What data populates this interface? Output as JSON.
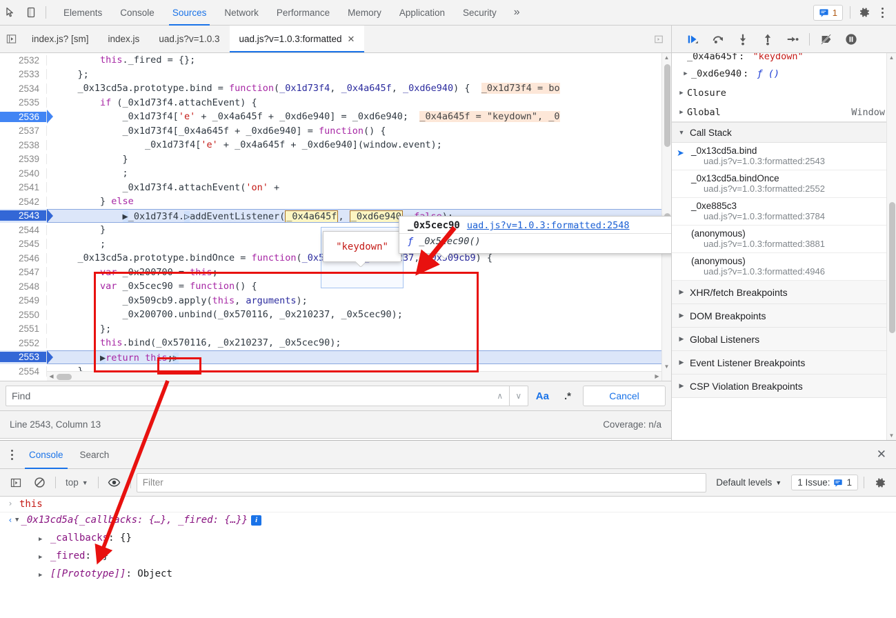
{
  "toolbar": {
    "inspect_icon": "inspect-cursor-icon",
    "device_icon": "device-toggle-icon",
    "panels": [
      {
        "label": "Elements",
        "active": false
      },
      {
        "label": "Console",
        "active": false
      },
      {
        "label": "Sources",
        "active": true
      },
      {
        "label": "Network",
        "active": false
      },
      {
        "label": "Performance",
        "active": false
      },
      {
        "label": "Memory",
        "active": false
      },
      {
        "label": "Application",
        "active": false
      },
      {
        "label": "Security",
        "active": false
      }
    ],
    "more_label": "»",
    "issues_count": "1",
    "accent": "#1a73e8"
  },
  "file_tabs": {
    "navigator_toggle": "show-navigator-icon",
    "tabs": [
      {
        "label": "index.js? [sm]",
        "active": false,
        "closable": false
      },
      {
        "label": "index.js",
        "active": false,
        "closable": false
      },
      {
        "label": "uad.js?v=1.0.3",
        "active": false,
        "closable": false
      },
      {
        "label": "uad.js?v=1.0.3:formatted",
        "active": true,
        "closable": true
      }
    ],
    "more_tabs_icon": "more-tabs-icon"
  },
  "debug_controls": [
    {
      "name": "resume-script-execution",
      "icon": "resume-icon"
    },
    {
      "name": "step-over-next-function-call",
      "icon": "step-over-icon"
    },
    {
      "name": "step-into-next-function-call",
      "icon": "step-into-icon"
    },
    {
      "name": "step-out-of-current-function",
      "icon": "step-out-icon"
    },
    {
      "name": "step",
      "icon": "step-icon"
    },
    {
      "name": "deactivate-breakpoints",
      "icon": "deactivate-breakpoints-icon"
    },
    {
      "name": "pause-on-exceptions",
      "icon": "pause-on-exceptions-icon"
    }
  ],
  "editor": {
    "lines": [
      {
        "num": "2532",
        "state": "normal",
        "code": "        this._fired = {};"
      },
      {
        "num": "2533",
        "state": "normal",
        "code": "    };"
      },
      {
        "num": "2534",
        "state": "normal",
        "code": "    _0x13cd5a.prototype.bind = function(_0x1d73f4, _0x4a645f, _0xd6e940) {",
        "hint": "_0x1d73f4 = bo"
      },
      {
        "num": "2535",
        "state": "normal",
        "code": "        if (_0x1d73f4.attachEvent) {"
      },
      {
        "num": "2536",
        "state": "breakpoint",
        "code": "            _0x1d73f4['e' + _0x4a645f + _0xd6e940] = _0xd6e940;",
        "hint": "_0x4a645f = \"keydown\", _0"
      },
      {
        "num": "2537",
        "state": "normal",
        "code": "            _0x1d73f4[_0x4a645f + _0xd6e940] = function() {"
      },
      {
        "num": "2538",
        "state": "normal",
        "code": "                _0x1d73f4['e' + _0x4a645f + _0xd6e940](window.event);"
      },
      {
        "num": "2539",
        "state": "normal",
        "code": "            }"
      },
      {
        "num": "2540",
        "state": "normal",
        "code": "            ;"
      },
      {
        "num": "2541",
        "state": "normal",
        "code": "            _0x1d73f4.attachEvent('on' + "
      },
      {
        "num": "2542",
        "state": "normal",
        "code": "        } else"
      },
      {
        "num": "2543",
        "state": "executing",
        "code": "            _0x1d73f4.addEventListener(_0x4a645f, _0xd6e940, false);"
      },
      {
        "num": "2544",
        "state": "normal",
        "code": "        }"
      },
      {
        "num": "2545",
        "state": "normal",
        "code": "        ;"
      },
      {
        "num": "2546",
        "state": "normal",
        "code": "    _0x13cd5a.prototype.bindOnce = function(_0x570116, _0x210237, _0x509cb9) {"
      },
      {
        "num": "2547",
        "state": "normal",
        "code": "        var _0x200700 = this;"
      },
      {
        "num": "2548",
        "state": "normal",
        "code": "        var _0x5cec90 = function() {"
      },
      {
        "num": "2549",
        "state": "normal",
        "code": "            _0x509cb9.apply(this, arguments);"
      },
      {
        "num": "2550",
        "state": "normal",
        "code": "            _0x200700.unbind(_0x570116, _0x210237, _0x5cec90);"
      },
      {
        "num": "2551",
        "state": "normal",
        "code": "        };"
      },
      {
        "num": "2552",
        "state": "normal",
        "code": "        this.bind(_0x570116, _0x210237, _0x5cec90);"
      },
      {
        "num": "2553",
        "state": "executing",
        "code": "        return this;"
      },
      {
        "num": "2554",
        "state": "normal",
        "code": "    }"
      }
    ],
    "highlighted_tokens": [
      "_0x4a645f",
      "_0xd6e940",
      "this;"
    ]
  },
  "popups": {
    "value_tooltip": {
      "text": "\"keydown\"",
      "target_token": "_0x4a645f"
    },
    "function_tooltip": {
      "name": "_0x5cec90",
      "location": "uad.js?v=1.0.3:formatted:2548",
      "signature": "_0x5cec90()",
      "signature_prefix": "ƒ",
      "target_token": "_0xd6e940"
    }
  },
  "find_bar": {
    "placeholder": "Find",
    "value": "",
    "prev_label": "∧",
    "next_label": "∨",
    "match_case_label": "Aa",
    "regex_label": ".*",
    "cancel_label": "Cancel"
  },
  "status_bar": {
    "position": "Line 2543, Column 13",
    "coverage": "Coverage: n/a"
  },
  "sidebar": {
    "scope_rows": [
      {
        "indent": 1,
        "tri": "",
        "name": "_0x4a645f",
        "sep": ":",
        "value": "\"keydown\"",
        "value_kind": "string",
        "clipped": true
      },
      {
        "indent": 1,
        "tri": "▶",
        "name": "_0xd6e940",
        "sep": ":",
        "value": "ƒ ()",
        "value_kind": "function"
      },
      {
        "indent": 0,
        "tri": "▶",
        "name": "Closure",
        "sep": "",
        "value": "",
        "value_kind": "plain"
      },
      {
        "indent": 0,
        "tri": "▶",
        "name": "Global",
        "sep": "",
        "value": "",
        "value_kind": "plain",
        "right": "Window"
      }
    ],
    "call_stack_header": "Call Stack",
    "call_stack": [
      {
        "name": "_0x13cd5a.bind",
        "location": "uad.js?v=1.0.3:formatted:2543",
        "current": true
      },
      {
        "name": "_0x13cd5a.bindOnce",
        "location": "uad.js?v=1.0.3:formatted:2552",
        "current": false
      },
      {
        "name": "_0xe885c3",
        "location": "uad.js?v=1.0.3:formatted:3784",
        "current": false
      },
      {
        "name": "(anonymous)",
        "location": "uad.js?v=1.0.3:formatted:3881",
        "current": false
      },
      {
        "name": "(anonymous)",
        "location": "uad.js?v=1.0.3:formatted:4946",
        "current": false
      }
    ],
    "breakpoint_sections": [
      {
        "label": "XHR/fetch Breakpoints"
      },
      {
        "label": "DOM Breakpoints"
      },
      {
        "label": "Global Listeners"
      },
      {
        "label": "Event Listener Breakpoints"
      },
      {
        "label": "CSP Violation Breakpoints"
      }
    ]
  },
  "drawer": {
    "tabs": [
      {
        "label": "Console",
        "active": true
      },
      {
        "label": "Search",
        "active": false
      }
    ],
    "close_label": "✕",
    "console_toolbar": {
      "sidebar_icon": "console-sidebar-icon",
      "clear_icon": "clear-console-icon",
      "context": "top",
      "context_caret": "▼",
      "eye_icon": "live-expression-icon",
      "filter_placeholder": "Filter",
      "filter_value": "",
      "levels_label": "Default levels",
      "levels_caret": "▼",
      "issues_label": "1 Issue:",
      "issues_count": "1",
      "settings_icon": "console-settings-icon"
    },
    "messages": [
      {
        "type": "input",
        "prompt": "›",
        "text": "this"
      },
      {
        "type": "output",
        "prompt": "‹",
        "tri": "▼",
        "constructor": "_0x13cd5a",
        "preview": "{_callbacks: {…}, _fired: {…}}",
        "badge": "i",
        "children": [
          {
            "tri": "▶",
            "key": "_callbacks",
            "value": "{}"
          },
          {
            "tri": "▶",
            "key": "_fired",
            "value": "{}"
          },
          {
            "tri": "▶",
            "key": "[[Prototype]]",
            "value": "Object",
            "italic": true
          }
        ]
      }
    ]
  },
  "annotations": {
    "accent": "#e8110f",
    "boxes": [
      {
        "name": "code-block-highlight-box"
      },
      {
        "name": "return-this-highlight-box"
      }
    ],
    "arrows": [
      {
        "name": "arrow-to-bindonce-function"
      },
      {
        "name": "arrow-from-return-this-to-console-output"
      }
    ]
  }
}
